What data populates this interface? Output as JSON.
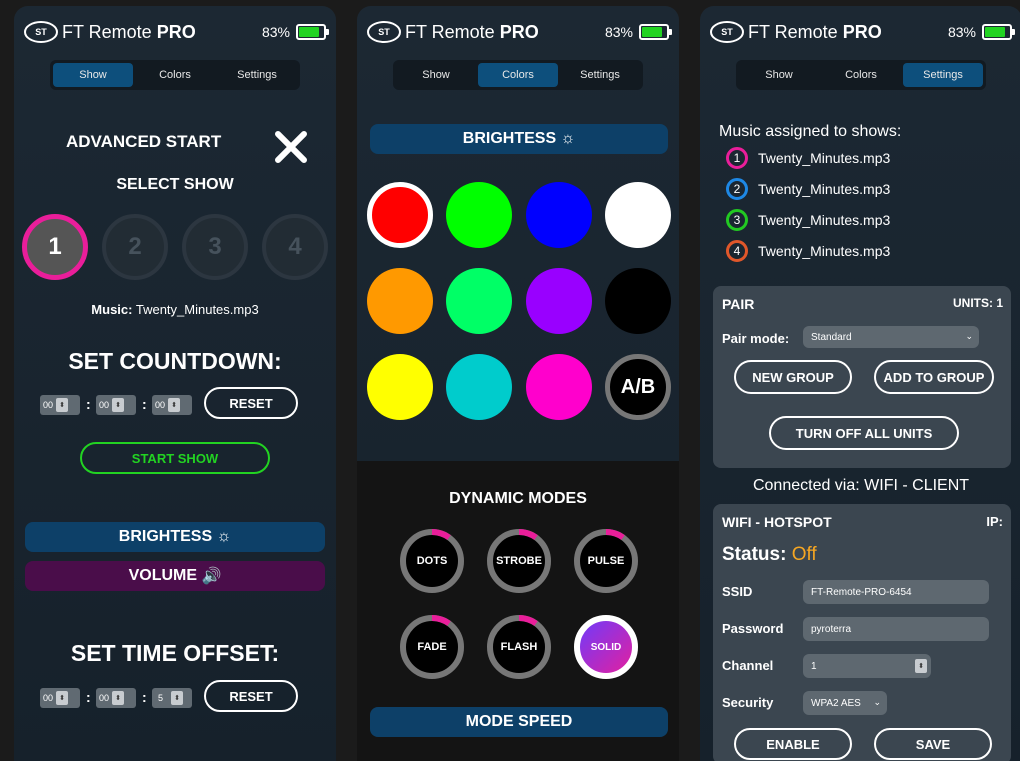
{
  "app": {
    "title_light": "FT Remote ",
    "title_bold": "PRO",
    "battery": "83%",
    "battery_level": 0.83
  },
  "tabs": [
    "Show",
    "Colors",
    "Settings"
  ],
  "show": {
    "advanced_start": "ADVANCED START",
    "select_show": "SELECT SHOW",
    "show_buttons": [
      "1",
      "2",
      "3",
      "4"
    ],
    "music_label": "Music:",
    "music_file": "Twenty_Minutes.mp3",
    "set_countdown": "SET COUNTDOWN:",
    "countdown_values": [
      "00",
      "00",
      "00"
    ],
    "reset_label": "RESET",
    "start_show": "START SHOW",
    "brightness": "BRIGHTESS",
    "volume": "VOLUME",
    "set_time_offset": "SET TIME OFFSET:",
    "offset_values": [
      "00",
      "00",
      "5"
    ],
    "separator": ":"
  },
  "colors": {
    "brightness": "BRIGHTESS",
    "swatches": [
      "#ff0000",
      "#00ff00",
      "#0000ff",
      "#ffffff",
      "#ff9900",
      "#00ff66",
      "#9900ff",
      "#000000",
      "#ffff00",
      "#00cccc",
      "#ff00cc"
    ],
    "ab_label": "A/B",
    "dynamic_modes_title": "DYNAMIC MODES",
    "modes": [
      "DOTS",
      "STROBE",
      "PULSE",
      "FADE",
      "FLASH",
      "SOLID"
    ],
    "mode_speed": "MODE SPEED"
  },
  "settings": {
    "music_title": "Music assigned to shows:",
    "music": [
      {
        "num": "1",
        "file": "Twenty_Minutes.mp3",
        "color": "#e91e9a"
      },
      {
        "num": "2",
        "file": "Twenty_Minutes.mp3",
        "color": "#1e88e5"
      },
      {
        "num": "3",
        "file": "Twenty_Minutes.mp3",
        "color": "#22c922"
      },
      {
        "num": "4",
        "file": "Twenty_Minutes.mp3",
        "color": "#e0572a"
      }
    ],
    "pair_title": "PAIR",
    "units": "UNITS: 1",
    "pair_mode_label": "Pair mode:",
    "pair_mode_value": "Standard",
    "new_group": "NEW GROUP",
    "add_to_group": "ADD TO GROUP",
    "turn_off_all": "TURN OFF ALL UNITS",
    "connected_via": "Connected via: WIFI - CLIENT",
    "wifi_title": "WIFI - HOTSPOT",
    "ip_label": "IP:",
    "status_label": "Status:",
    "status_value": "Off",
    "ssid_label": "SSID",
    "ssid_value": "FT-Remote-PRO-6454",
    "password_label": "Password",
    "password_value": "pyroterra",
    "channel_label": "Channel",
    "channel_value": "1",
    "security_label": "Security",
    "security_value": "WPA2 AES",
    "enable": "ENABLE",
    "save": "SAVE"
  },
  "colors_theme": {
    "accent_pink": "#e91e9a",
    "accent_green": "#22d322",
    "accent_blue": "#0d4f7c",
    "status_off": "#f5a623"
  }
}
